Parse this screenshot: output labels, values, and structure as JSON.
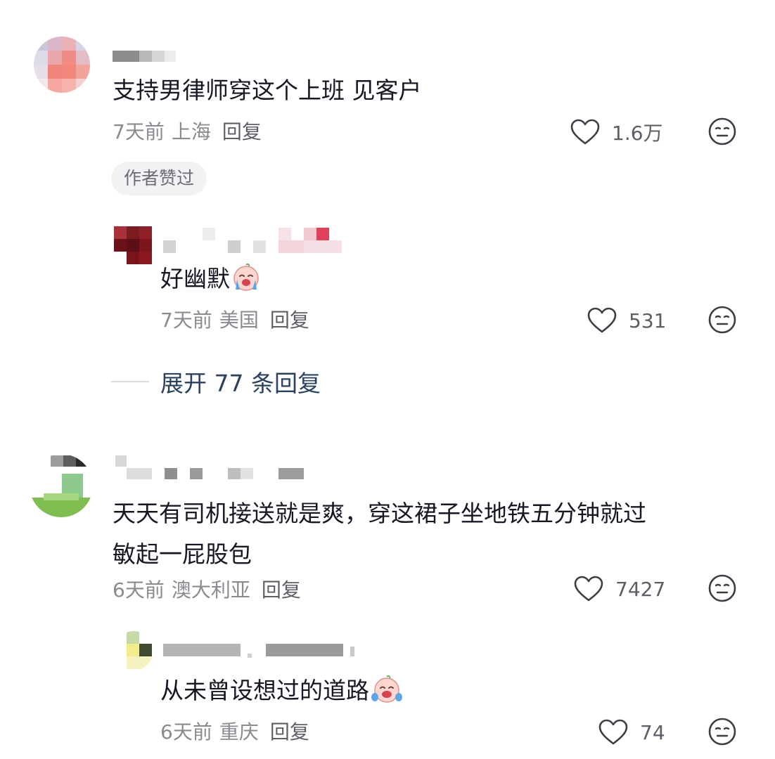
{
  "comments": [
    {
      "text": "支持男律师穿这个上班 见客户",
      "time": "7天前",
      "location": "上海",
      "reply_label": "回复",
      "likes": "1.6万",
      "badge": "作者赞过",
      "replies": [
        {
          "text": "好幽默",
          "emoji": "crying-laughing-emoji",
          "time": "7天前",
          "location": "美国",
          "reply_label": "回复",
          "likes": "531"
        }
      ],
      "expand_label": "展开 77 条回复"
    },
    {
      "text_line1": "天天有司机接送就是爽，穿这裙子坐地铁五分钟就过",
      "text_line2": "敏起一屁股包",
      "time": "6天前",
      "location": "澳大利亚",
      "reply_label": "回复",
      "likes": "7427",
      "replies": [
        {
          "text": "从未曾设想过的道路",
          "emoji": "crying-laughing-emoji",
          "time": "6天前",
          "location": "重庆",
          "reply_label": "回复",
          "likes": "74"
        }
      ]
    }
  ],
  "icons": {
    "like": "heart-outline-icon",
    "dislike": "meh-face-icon"
  },
  "colors": {
    "text": "#161823",
    "meta": "#8a8b91",
    "expand": "#2a4160"
  }
}
